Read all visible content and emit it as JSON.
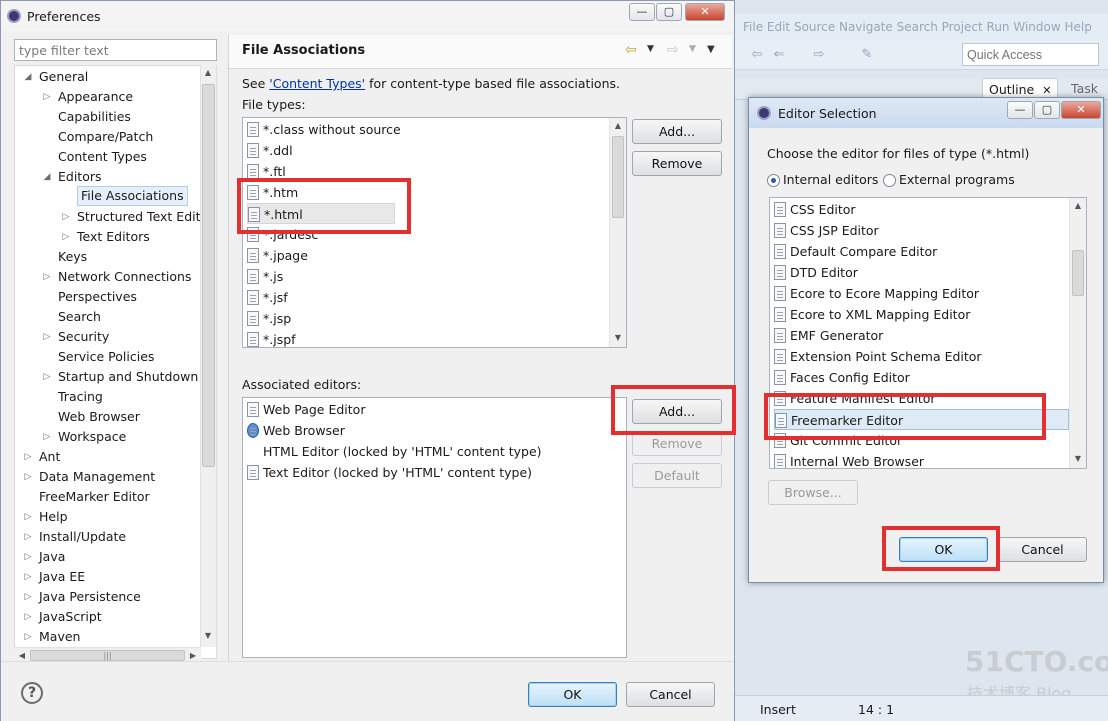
{
  "eclipse": {
    "menu_text": "File  Edit  Source  Navigate  Search  Project  Run  Window  Help",
    "quick_access": "Quick Access",
    "outline_tab": "Outline",
    "task_tab": "Task",
    "status_mode": "Insert",
    "status_position": "14 : 1",
    "watermark_main": "51CTO.com",
    "watermark_sub": "技术博客 Blog"
  },
  "prefs": {
    "title": "Preferences",
    "filter_placeholder": "type filter text",
    "tree": [
      {
        "label": "General",
        "level": 0,
        "arrow": "expanded"
      },
      {
        "label": "Appearance",
        "level": 1,
        "arrow": "collapsed"
      },
      {
        "label": "Capabilities",
        "level": 1,
        "arrow": "none"
      },
      {
        "label": "Compare/Patch",
        "level": 1,
        "arrow": "none"
      },
      {
        "label": "Content Types",
        "level": 1,
        "arrow": "none"
      },
      {
        "label": "Editors",
        "level": 1,
        "arrow": "expanded"
      },
      {
        "label": "File Associations",
        "level": 2,
        "arrow": "none",
        "selected": true
      },
      {
        "label": "Structured Text Editor",
        "level": 2,
        "arrow": "collapsed"
      },
      {
        "label": "Text Editors",
        "level": 2,
        "arrow": "collapsed"
      },
      {
        "label": "Keys",
        "level": 1,
        "arrow": "none"
      },
      {
        "label": "Network Connections",
        "level": 1,
        "arrow": "collapsed"
      },
      {
        "label": "Perspectives",
        "level": 1,
        "arrow": "none"
      },
      {
        "label": "Search",
        "level": 1,
        "arrow": "none"
      },
      {
        "label": "Security",
        "level": 1,
        "arrow": "collapsed"
      },
      {
        "label": "Service Policies",
        "level": 1,
        "arrow": "none"
      },
      {
        "label": "Startup and Shutdown",
        "level": 1,
        "arrow": "collapsed"
      },
      {
        "label": "Tracing",
        "level": 1,
        "arrow": "none"
      },
      {
        "label": "Web Browser",
        "level": 1,
        "arrow": "none"
      },
      {
        "label": "Workspace",
        "level": 1,
        "arrow": "collapsed"
      },
      {
        "label": "Ant",
        "level": 0,
        "arrow": "collapsed"
      },
      {
        "label": "Data Management",
        "level": 0,
        "arrow": "collapsed"
      },
      {
        "label": "FreeMarker Editor",
        "level": 0,
        "arrow": "none"
      },
      {
        "label": "Help",
        "level": 0,
        "arrow": "collapsed"
      },
      {
        "label": "Install/Update",
        "level": 0,
        "arrow": "collapsed"
      },
      {
        "label": "Java",
        "level": 0,
        "arrow": "collapsed"
      },
      {
        "label": "Java EE",
        "level": 0,
        "arrow": "collapsed"
      },
      {
        "label": "Java Persistence",
        "level": 0,
        "arrow": "collapsed"
      },
      {
        "label": "JavaScript",
        "level": 0,
        "arrow": "collapsed"
      },
      {
        "label": "Maven",
        "level": 0,
        "arrow": "collapsed"
      }
    ],
    "page_title": "File Associations",
    "see_prefix": "See ",
    "see_link": "'Content Types'",
    "see_suffix": " for content-type based file associations.",
    "file_types_label": "File types:",
    "file_types": [
      {
        "label": "*.class without source",
        "icon": "class-file-icon"
      },
      {
        "label": "*.ddl",
        "icon": "ddl-file-icon"
      },
      {
        "label": "*.ftl",
        "icon": "ftl-file-icon"
      },
      {
        "label": "*.htm",
        "icon": "html-file-icon"
      },
      {
        "label": "*.html",
        "icon": "html-file-icon",
        "selected": true
      },
      {
        "label": "*.jardesc",
        "icon": "jar-file-icon"
      },
      {
        "label": "*.jpage",
        "icon": "jpage-file-icon"
      },
      {
        "label": "*.js",
        "icon": "js-file-icon"
      },
      {
        "label": "*.jsf",
        "icon": "jsf-file-icon"
      },
      {
        "label": "*.jsp",
        "icon": "jsp-file-icon"
      },
      {
        "label": "*.jspf",
        "icon": "jsp-file-icon"
      }
    ],
    "file_add": "Add...",
    "file_remove": "Remove",
    "assoc_label": "Associated editors:",
    "assoc_editors": [
      {
        "label": "Web Page Editor",
        "icon": "web-page-editor-icon"
      },
      {
        "label": "Web Browser",
        "icon": "globe-icon"
      },
      {
        "label": "HTML Editor (locked by 'HTML' content type)",
        "icon": "none"
      },
      {
        "label": "Text Editor (locked by 'HTML' content type)",
        "icon": "text-file-icon"
      }
    ],
    "assoc_add": "Add...",
    "assoc_remove": "Remove",
    "assoc_default": "Default",
    "ok": "OK",
    "cancel": "Cancel"
  },
  "editor_selection": {
    "title": "Editor Selection",
    "prompt": "Choose the editor for files of type (*.html)",
    "radio_internal": "Internal editors",
    "radio_external": "External programs",
    "editors": [
      {
        "label": "CSS Editor"
      },
      {
        "label": "CSS JSP Editor"
      },
      {
        "label": "Default Compare Editor"
      },
      {
        "label": "DTD Editor"
      },
      {
        "label": "Ecore to Ecore Mapping Editor"
      },
      {
        "label": "Ecore to XML Mapping Editor"
      },
      {
        "label": "EMF Generator"
      },
      {
        "label": "Extension Point Schema Editor"
      },
      {
        "label": "Faces Config Editor"
      },
      {
        "label": "Feature Manifest Editor"
      },
      {
        "label": "Freemarker Editor",
        "selected": true
      },
      {
        "label": "Git Commit Editor"
      },
      {
        "label": "Internal Web Browser"
      }
    ],
    "browse": "Browse...",
    "ok": "OK",
    "cancel": "Cancel"
  },
  "colors": {
    "highlight": "#e23030",
    "link": "#0033a0",
    "selection": "#e5f0fb"
  }
}
